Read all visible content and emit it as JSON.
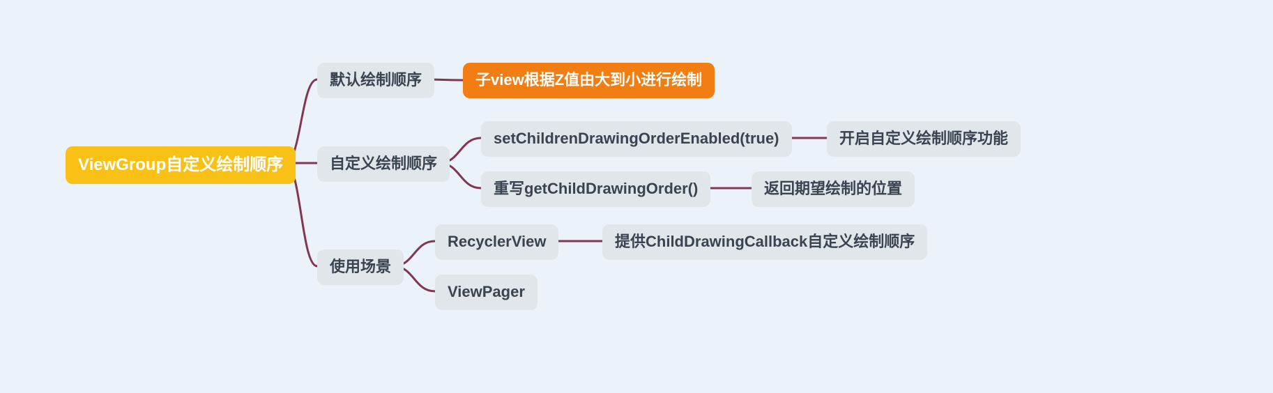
{
  "root": {
    "label": "ViewGroup自定义绘制顺序"
  },
  "b1": {
    "label": "默认绘制顺序"
  },
  "b1c1": {
    "label": "子view根据Z值由大到小进行绘制"
  },
  "b2": {
    "label": "自定义绘制顺序"
  },
  "b2c1": {
    "label": "setChildrenDrawingOrderEnabled(true)"
  },
  "b2c1_1": {
    "label": "开启自定义绘制顺序功能"
  },
  "b2c2": {
    "label": "重写getChildDrawingOrder()"
  },
  "b2c2_1": {
    "label": "返回期望绘制的位置"
  },
  "b3": {
    "label": "使用场景"
  },
  "b3c1": {
    "label": "RecyclerView"
  },
  "b3c1_1": {
    "label": "提供ChildDrawingCallback自定义绘制顺序"
  },
  "b3c2": {
    "label": "ViewPager"
  },
  "colors": {
    "background": "#ecf2f9",
    "node": "#e1e6ea",
    "node_text": "#3a4350",
    "root": "#f9c015",
    "highlight": "#f27d13",
    "connector": "#823654"
  }
}
